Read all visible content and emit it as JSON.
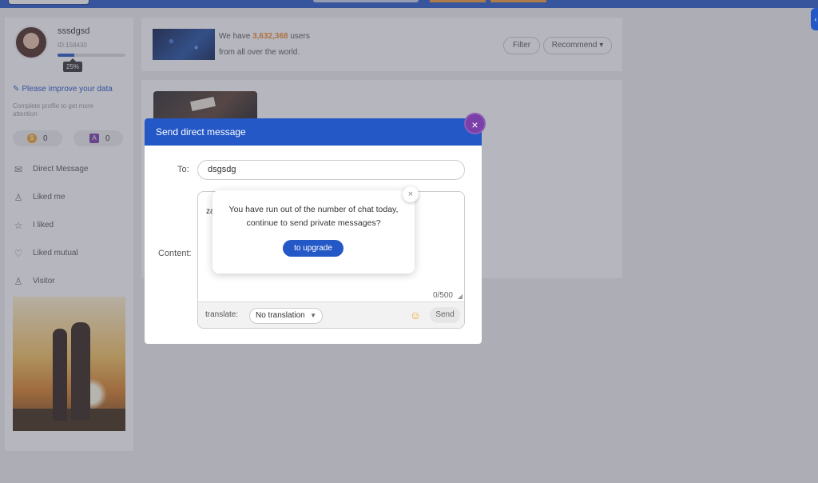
{
  "colors": {
    "brand": "#2458c6",
    "accent": "#f2892b",
    "purple": "#7a3fa8"
  },
  "profile": {
    "username": "sssdgsd",
    "id_label": "ID:158430",
    "progress": 0.25,
    "progress_label": "25%",
    "improve_text": "Please improve your data",
    "improve_sub": "Complete profile to get more attention",
    "coins": "0",
    "points": "0"
  },
  "menu": [
    {
      "label": "Direct Message",
      "icon": "mail-icon"
    },
    {
      "label": "Liked me",
      "icon": "person-icon"
    },
    {
      "label": "I liked",
      "icon": "star-icon"
    },
    {
      "label": "Liked mutual",
      "icon": "heart-icon"
    },
    {
      "label": "Visitor",
      "icon": "visitor-icon"
    }
  ],
  "stats": {
    "line1_prefix": "We have",
    "count": "3,632,368",
    "line1_suffix": "users",
    "line2": "from all over the world."
  },
  "toolbar": {
    "filter": "Filter",
    "recommend": "Recommend"
  },
  "dm": {
    "title": "Send direct message",
    "close": "×",
    "to_label": "To:",
    "to_value": "dsgsdg",
    "content_label": "Content:",
    "content_value": "za",
    "char_count": "0/500",
    "translate_label": "translate:",
    "translate_value": "No translation",
    "send": "Send"
  },
  "alert": {
    "line1": "You have run out of the number of chat today,",
    "line2": "continue to send private messages?",
    "button": "to upgrade",
    "close": "×"
  }
}
